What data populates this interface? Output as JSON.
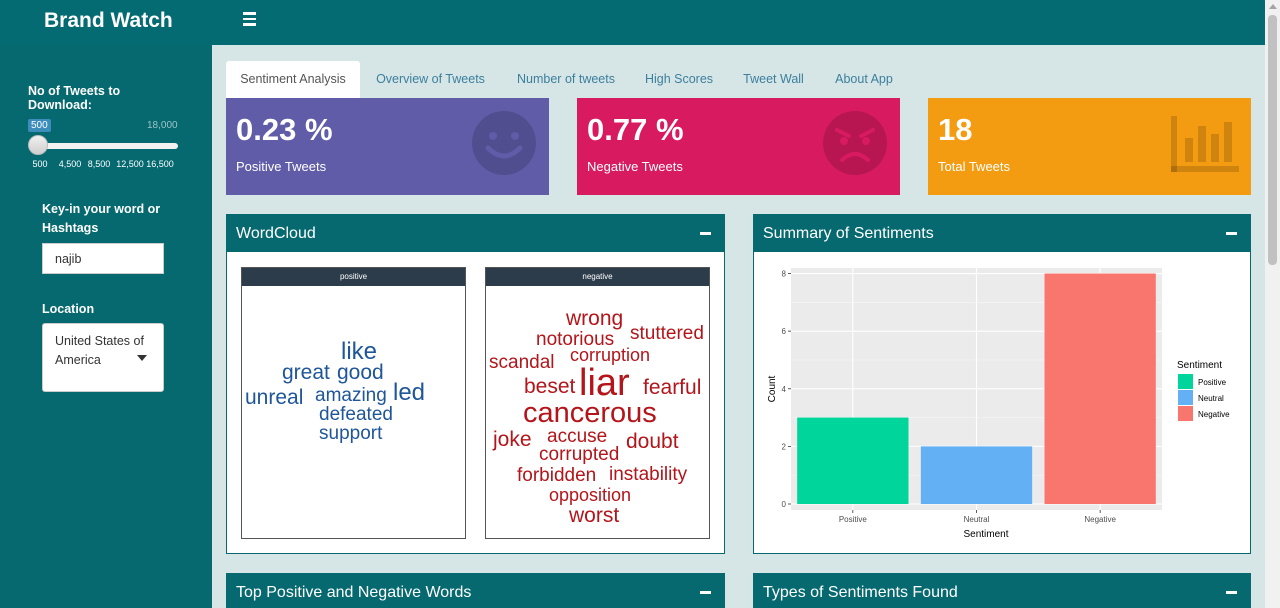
{
  "header": {
    "title": "Brand Watch"
  },
  "sidebar": {
    "slider": {
      "label": "No of Tweets to Download:",
      "value": "500",
      "max": "18,000",
      "ticks": [
        "500",
        "4,500",
        "8,500",
        "12,500",
        "16,500"
      ]
    },
    "keyword": {
      "label": "Key-in your word or Hashtags",
      "value": "najib"
    },
    "location": {
      "label": "Location",
      "value": "United States of America"
    }
  },
  "tabs": [
    "Sentiment Analysis",
    "Overview of Tweets",
    "Number of tweets",
    "High Scores",
    "Tweet Wall",
    "About App"
  ],
  "value_boxes": [
    {
      "value": "0.23 %",
      "label": "Positive Tweets",
      "color": "#605ca8",
      "icon": "smile-icon"
    },
    {
      "value": "0.77 %",
      "label": "Negative Tweets",
      "color": "#d81b60",
      "icon": "angry-face-icon"
    },
    {
      "value": "18",
      "label": "Total Tweets",
      "color": "#f39c12",
      "icon": "bar-chart-icon"
    }
  ],
  "panels": {
    "wordcloud": "WordCloud",
    "summary": "Summary of Sentiments",
    "top_words": "Top Positive and Negative Words",
    "types": "Types of Sentiments Found"
  },
  "wordcloud": {
    "positive_label": "positive",
    "negative_label": "negative",
    "positive_words": [
      "like",
      "great",
      "good",
      "unreal",
      "amazing",
      "led",
      "defeated",
      "support"
    ],
    "negative_words": [
      "wrong",
      "notorious",
      "stuttered",
      "scandal",
      "corruption",
      "beset",
      "liar",
      "fearful",
      "cancerous",
      "joke",
      "accuse",
      "doubt",
      "corrupted",
      "forbidden",
      "instability",
      "opposition",
      "worst"
    ]
  },
  "chart_data": {
    "type": "bar",
    "categories": [
      "Positive",
      "Neutral",
      "Negative"
    ],
    "values": [
      3,
      2,
      8
    ],
    "colors": [
      "#00d59c",
      "#64b0f5",
      "#f8766d"
    ],
    "xlabel": "Sentiment",
    "ylabel": "Count",
    "ylim": [
      0,
      8.4
    ],
    "yticks": [
      0,
      2,
      4,
      6,
      8
    ],
    "legend_title": "Sentiment",
    "legend_position": "right",
    "grid": true
  }
}
